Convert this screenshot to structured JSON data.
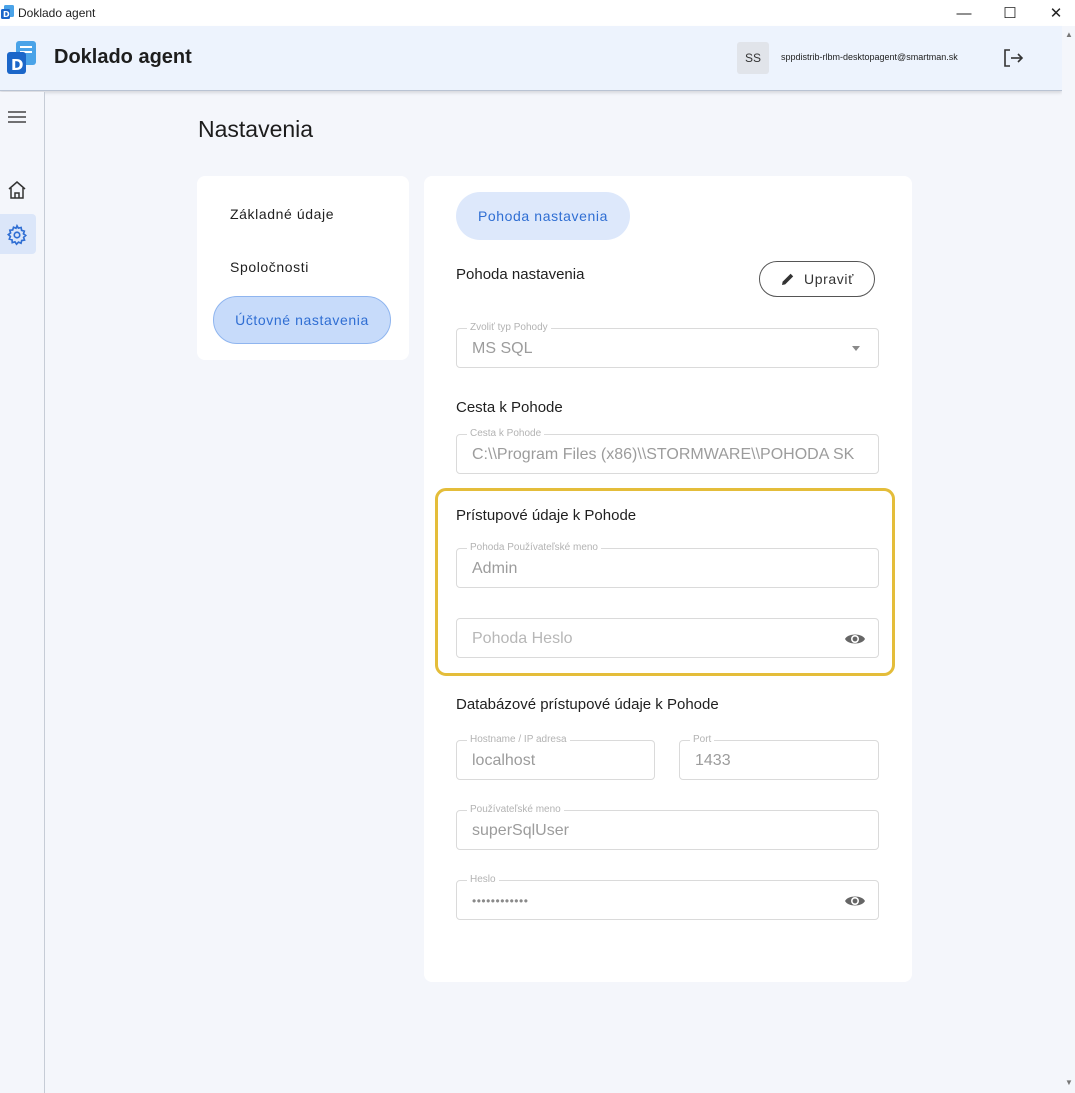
{
  "window": {
    "title": "Doklado agent",
    "minimize": "—",
    "maximize": "☐",
    "close": "✕"
  },
  "header": {
    "app_name": "Doklado agent",
    "user_initials": "SS",
    "user_email": "sppdistrib-rlbm-desktopagent@smartman.sk"
  },
  "page": {
    "title": "Nastavenia"
  },
  "side_menu": {
    "items": [
      {
        "label": "Základné údaje"
      },
      {
        "label": "Spoločnosti"
      },
      {
        "label": "Účtovné nastavenia",
        "active": true
      }
    ]
  },
  "main": {
    "tab_label": "Pohoda nastavenia",
    "section1_title": "Pohoda nastavenia",
    "edit_label": "Upraviť",
    "pohoda_type": {
      "label": "Zvoliť typ Pohody",
      "value": "MS SQL"
    },
    "path_section_title": "Cesta k Pohode",
    "path": {
      "label": "Cesta k Pohode",
      "value": "C:\\\\Program Files (x86)\\\\STORMWARE\\\\POHODA SK"
    },
    "access_section_title": "Prístupové údaje k Pohode",
    "pohoda_username": {
      "label": "Pohoda Používateľské meno",
      "value": "Admin"
    },
    "pohoda_password": {
      "placeholder": "Pohoda Heslo"
    },
    "db_section_title": "Databázové prístupové údaje k Pohode",
    "hostname": {
      "label": "Hostname / IP adresa",
      "value": "localhost"
    },
    "port": {
      "label": "Port",
      "value": "1433"
    },
    "db_username": {
      "label": "Používateľské meno",
      "value": "superSqlUser"
    },
    "db_password": {
      "label": "Heslo",
      "value": "••••••••••••"
    }
  },
  "colors": {
    "accent": "#2f6ed3",
    "highlight": "#e4bd3a",
    "header_bg": "#edf3fd",
    "page_bg": "#f4f6fb"
  }
}
